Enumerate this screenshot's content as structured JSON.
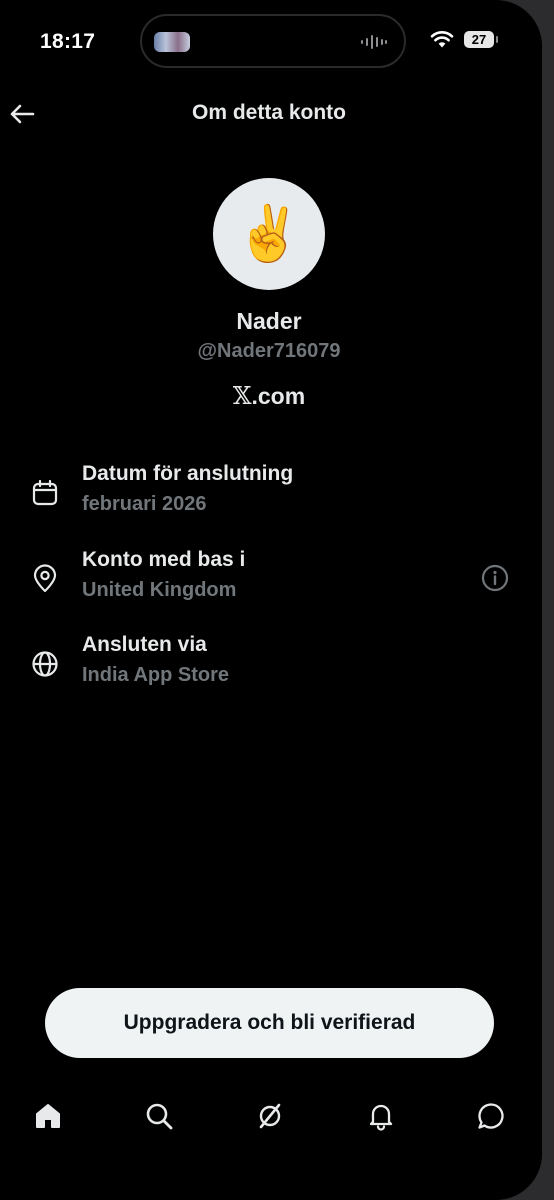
{
  "status_bar": {
    "time": "18:17",
    "battery": "27",
    "icons": [
      "island-thumbnail",
      "audio-wave-icon",
      "wifi-icon",
      "battery-icon"
    ]
  },
  "header": {
    "title": "Om detta konto",
    "back_icon": "arrow-left-icon"
  },
  "profile": {
    "avatar_emoji": "✌️",
    "name": "Nader",
    "handle": "@Nader716079",
    "site_glyph": "𝕏",
    "site_suffix": ".com"
  },
  "info": [
    {
      "icon": "calendar-icon",
      "label": "Datum för anslutning",
      "value": "februari 2026"
    },
    {
      "icon": "location-pin-icon",
      "label": "Konto med bas i",
      "value": "United Kingdom",
      "action_icon": "info-icon"
    },
    {
      "icon": "globe-icon",
      "label": "Ansluten via",
      "value": "India App Store"
    }
  ],
  "upgrade_button": "Uppgradera och bli verifierad",
  "tabbar": {
    "items": [
      "home-icon",
      "search-icon",
      "grok-icon",
      "notifications-bell-icon",
      "messages-icon"
    ],
    "active": "home-icon"
  },
  "colors": {
    "background": "#000000",
    "text_primary": "#e7e9ea",
    "text_secondary": "#71767b",
    "button_bg": "#eff3f4"
  }
}
